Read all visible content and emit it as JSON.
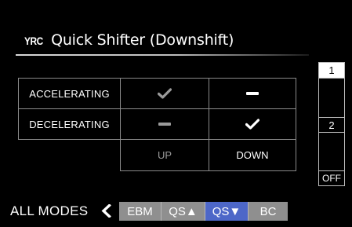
{
  "header": {
    "brand": "YRC",
    "title": "Quick Shifter (Downshift)"
  },
  "matrix": {
    "rows": [
      {
        "label": "ACCELERATING",
        "up": "check",
        "down": "dash"
      },
      {
        "label": "DECELERATING",
        "up": "dash",
        "down": "check"
      }
    ],
    "columns": {
      "up": "UP",
      "down": "DOWN"
    },
    "colors": {
      "up_column": "#9a9a9a",
      "down_column": "#ffffff"
    }
  },
  "gear_scale": {
    "selected": "1",
    "labels": [
      "1",
      "2",
      "OFF"
    ]
  },
  "footer": {
    "all_modes_label": "ALL MODES",
    "tabs": [
      {
        "label": "EBM",
        "active": false
      },
      {
        "label": "QS▲",
        "active": false
      },
      {
        "label": "QS▼",
        "active": true
      },
      {
        "label": "BC",
        "active": false
      }
    ],
    "colors": {
      "tab": "#8f8f8f",
      "active_tab": "#4d67c8"
    }
  }
}
